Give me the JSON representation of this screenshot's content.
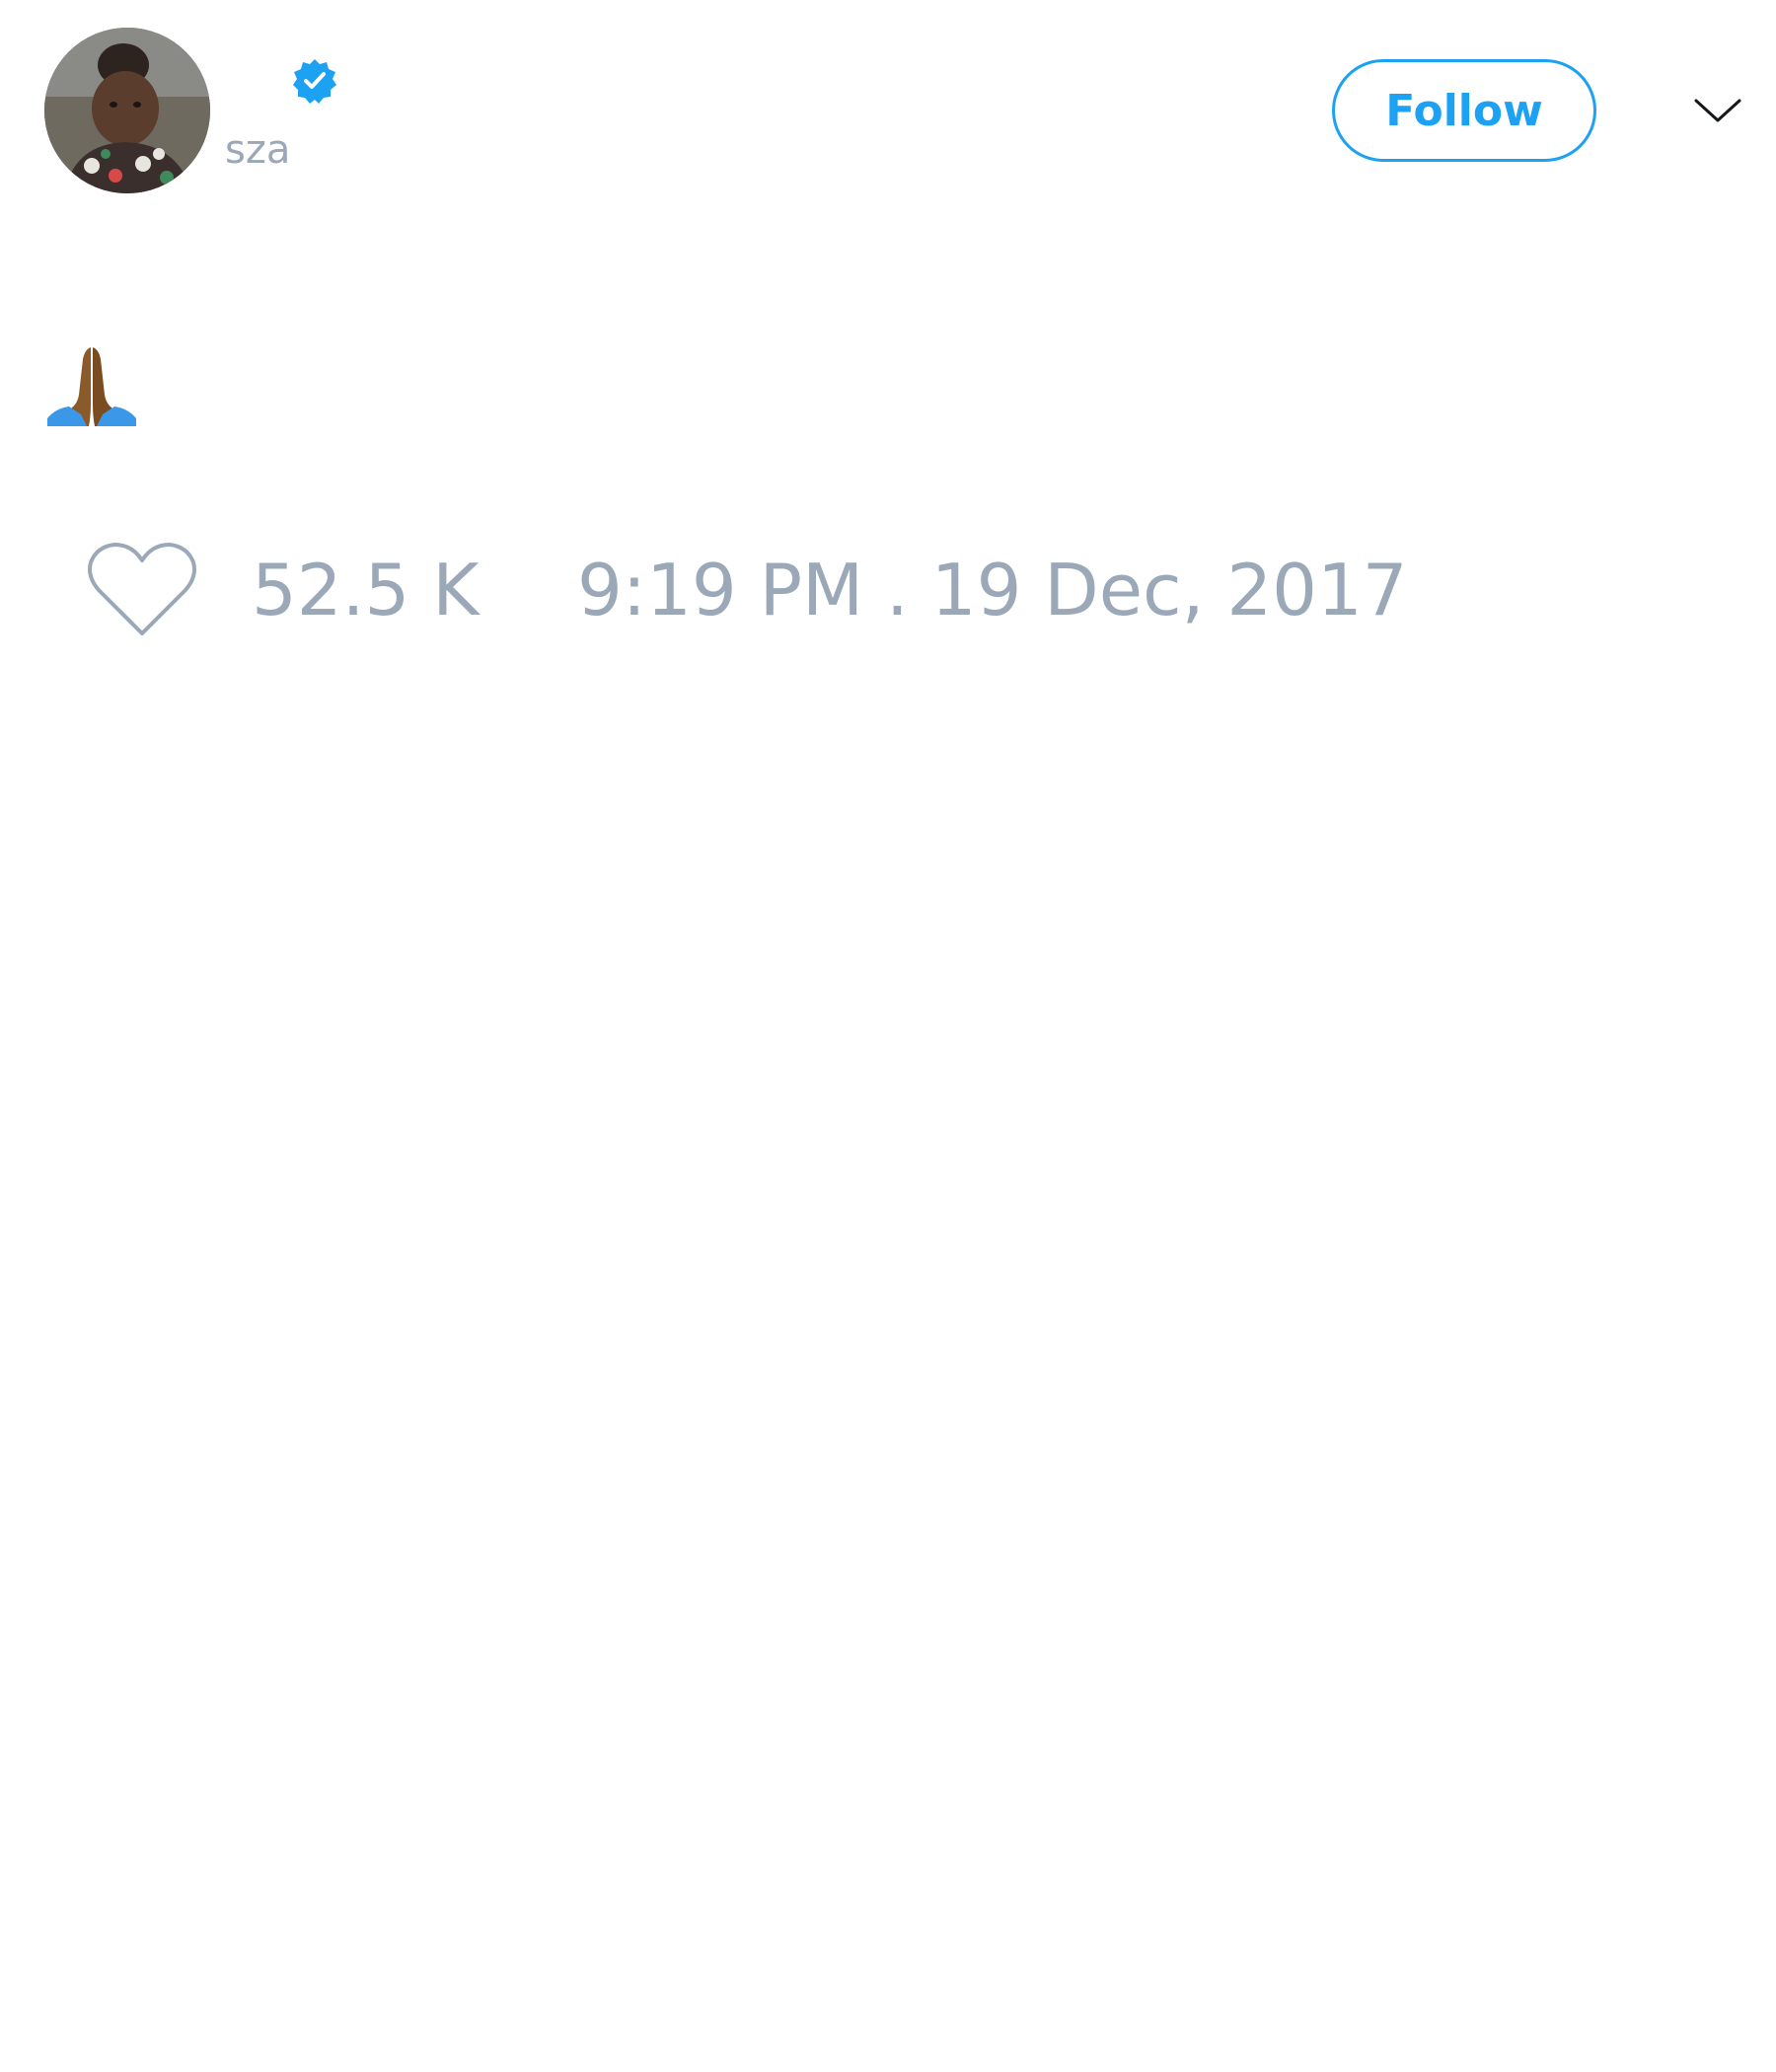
{
  "tweet": {
    "author": {
      "handle": "sza",
      "verified_icon": "verified-badge-icon",
      "avatar": "profile-photo"
    },
    "follow_label": "Follow",
    "menu_icon": "chevron-down-icon",
    "content_emoji": "🙏🏾",
    "like_icon": "heart-icon",
    "likes": "52.5 K",
    "timestamp": "9:19 PM . 19 Dec, 2017"
  },
  "colors": {
    "accent": "#1da1f2",
    "muted_text": "#9aa8b8",
    "background": "#ffffff"
  }
}
